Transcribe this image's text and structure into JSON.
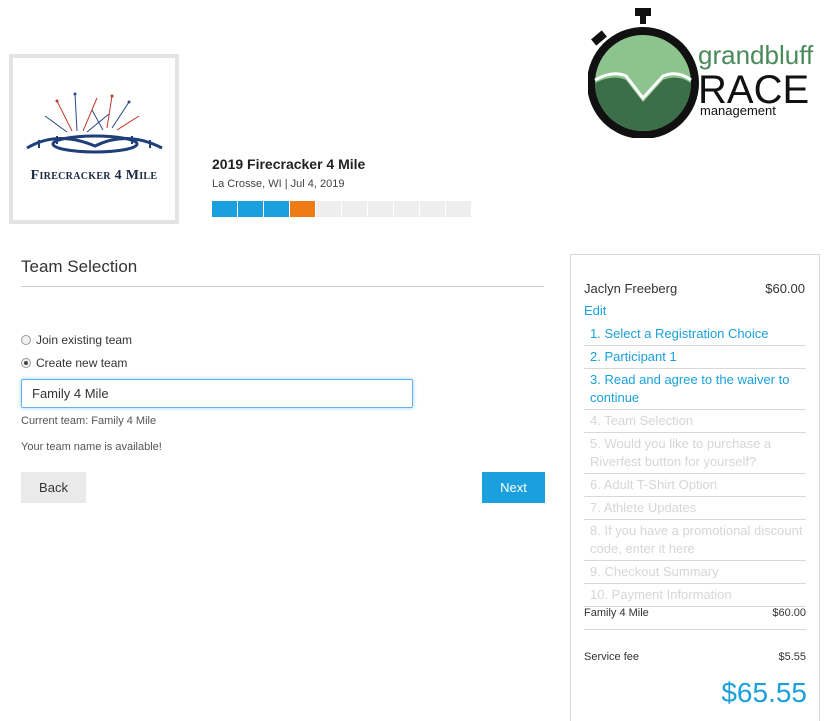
{
  "event": {
    "logo_text": "Firecracker 4 Mile",
    "title": "2019 Firecracker 4 Mile",
    "subtitle": "La Crosse, WI | Jul 4, 2019",
    "progress": {
      "completed_steps": 3,
      "current_step": 4,
      "total_steps": 10
    }
  },
  "brand": {
    "line1": "grandbluff",
    "line2": "RACE",
    "line3": "management"
  },
  "form": {
    "section_title": "Team Selection",
    "option_join": "Join existing team",
    "option_create": "Create new team",
    "selected_option": "create",
    "team_name_value": "Family 4 Mile",
    "current_team": "Current team: Family 4 Mile",
    "availability": "Your team name is available!",
    "back_label": "Back",
    "next_label": "Next"
  },
  "summary": {
    "participant": "Jaclyn Freeberg",
    "participant_price": "$60.00",
    "edit_label": "Edit",
    "steps": [
      {
        "label": "1. Select a Registration Choice",
        "state": "active"
      },
      {
        "label": "2. Participant 1",
        "state": "active"
      },
      {
        "label": "3. Read and agree to the waiver to continue",
        "state": "active"
      },
      {
        "label": "4. Team Selection",
        "state": "inactive"
      },
      {
        "label": "5. Would you like to purchase a Riverfest button for yourself?",
        "state": "inactive"
      },
      {
        "label": "6. Adult T-Shirt Option",
        "state": "inactive"
      },
      {
        "label": "7. Athlete Updates",
        "state": "inactive"
      },
      {
        "label": "8. If you have a promotional discount code, enter it here",
        "state": "inactive"
      },
      {
        "label": "9. Checkout Summary",
        "state": "inactive"
      },
      {
        "label": "10. Payment Information",
        "state": "inactive"
      }
    ],
    "team_line": {
      "label": "Family 4 Mile",
      "value": "$60.00"
    },
    "fee_line": {
      "label": "Service fee",
      "value": "$5.55"
    },
    "total": "$65.55"
  },
  "colors": {
    "accent": "#1aa0dc",
    "current_step": "#f07b14",
    "brand_green_dark": "#3d6e4a",
    "brand_green_light": "#7db87f"
  }
}
